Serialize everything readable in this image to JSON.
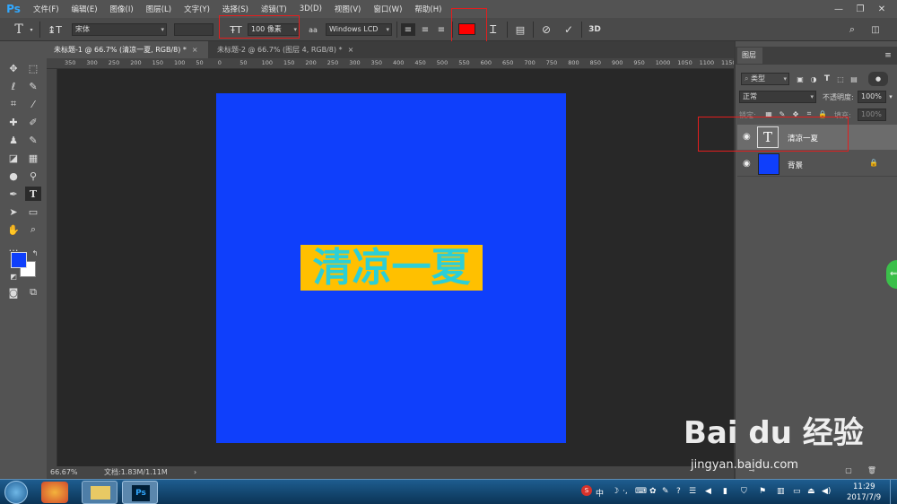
{
  "app": {
    "logo": "Ps"
  },
  "menu": [
    "文件(F)",
    "编辑(E)",
    "图像(I)",
    "图层(L)",
    "文字(Y)",
    "选择(S)",
    "滤镜(T)",
    "3D(D)",
    "视图(V)",
    "窗口(W)",
    "帮助(H)"
  ],
  "options": {
    "tool_icon": "T",
    "font_family": "宋体",
    "font_style": "",
    "font_size": "100 像素",
    "aa_label": "aa",
    "antialias": "Windows LCD",
    "text_color": "#ff0000",
    "three_d": "3D"
  },
  "tabs": [
    {
      "label": "未标题-1 @ 66.7% (清凉一夏, RGB/8) *",
      "close": "×"
    },
    {
      "label": "未标题-2 @ 66.7% (图层 4, RGB/8) *",
      "close": "×"
    }
  ],
  "ruler": {
    "h": [
      "350",
      "300",
      "250",
      "200",
      "150",
      "100",
      "50",
      "0",
      "50",
      "100",
      "150",
      "200",
      "250",
      "300",
      "350",
      "400",
      "450",
      "500",
      "550",
      "600",
      "650",
      "700",
      "750",
      "800",
      "850",
      "900",
      "950",
      "1000",
      "1050",
      "1100",
      "1150"
    ]
  },
  "canvas": {
    "text": "清凉一夏",
    "doc_color": "#0f3ffb",
    "block_color": "#ffc000",
    "text_color": "#2ccfd6"
  },
  "status": {
    "zoom": "66.67%",
    "doc": "文档:1.83M/1.11M",
    "arrow": "›"
  },
  "layers_panel": {
    "tab": "图层",
    "filter": "类型",
    "blend_mode": "正常",
    "opacity_label": "不透明度:",
    "opacity": "100%",
    "lock_label": "锁定:",
    "fill_label": "填充:",
    "fill": "100%",
    "layers": [
      {
        "name": "清凉一夏",
        "type": "text",
        "thumb_text": "T",
        "selected": true
      },
      {
        "name": "背景",
        "type": "bg",
        "locked": true
      }
    ]
  },
  "taskbar": {
    "clock": "11:29",
    "date": "2017/7/9",
    "ime": "中",
    "ps": "Ps"
  },
  "watermark": {
    "brand": "Bai du 经验",
    "url": "jingyan.baidu.com"
  }
}
